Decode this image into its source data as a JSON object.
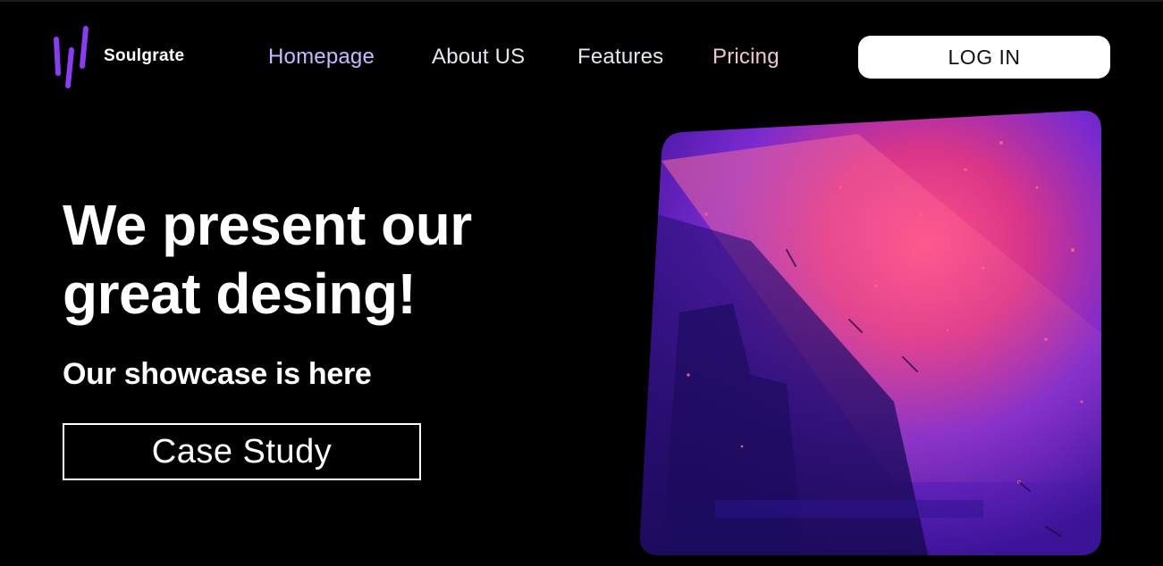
{
  "brand": {
    "name": "Soulgrate",
    "logo_icon": "three-bars-logo-icon",
    "logo_color": "#8a3cf0"
  },
  "nav": {
    "items": [
      {
        "label": "Homepage",
        "color": "#c9b8ff"
      },
      {
        "label": "About US",
        "color": "#e6e6f0"
      },
      {
        "label": "Features",
        "color": "#e6e6f0"
      },
      {
        "label": "Pricing",
        "color": "#f0c8c8"
      }
    ],
    "login_label": "LOG IN"
  },
  "hero": {
    "title": "We present our great desing!",
    "subtitle": "Our showcase is here",
    "cta_label": "Case Study",
    "image_description_icon": "abstract-purple-pink-image"
  },
  "colors": {
    "background": "#000000",
    "accent_purple": "#8a3cf0",
    "image_pink": "#e0407a",
    "image_violet": "#5a1fb8"
  }
}
